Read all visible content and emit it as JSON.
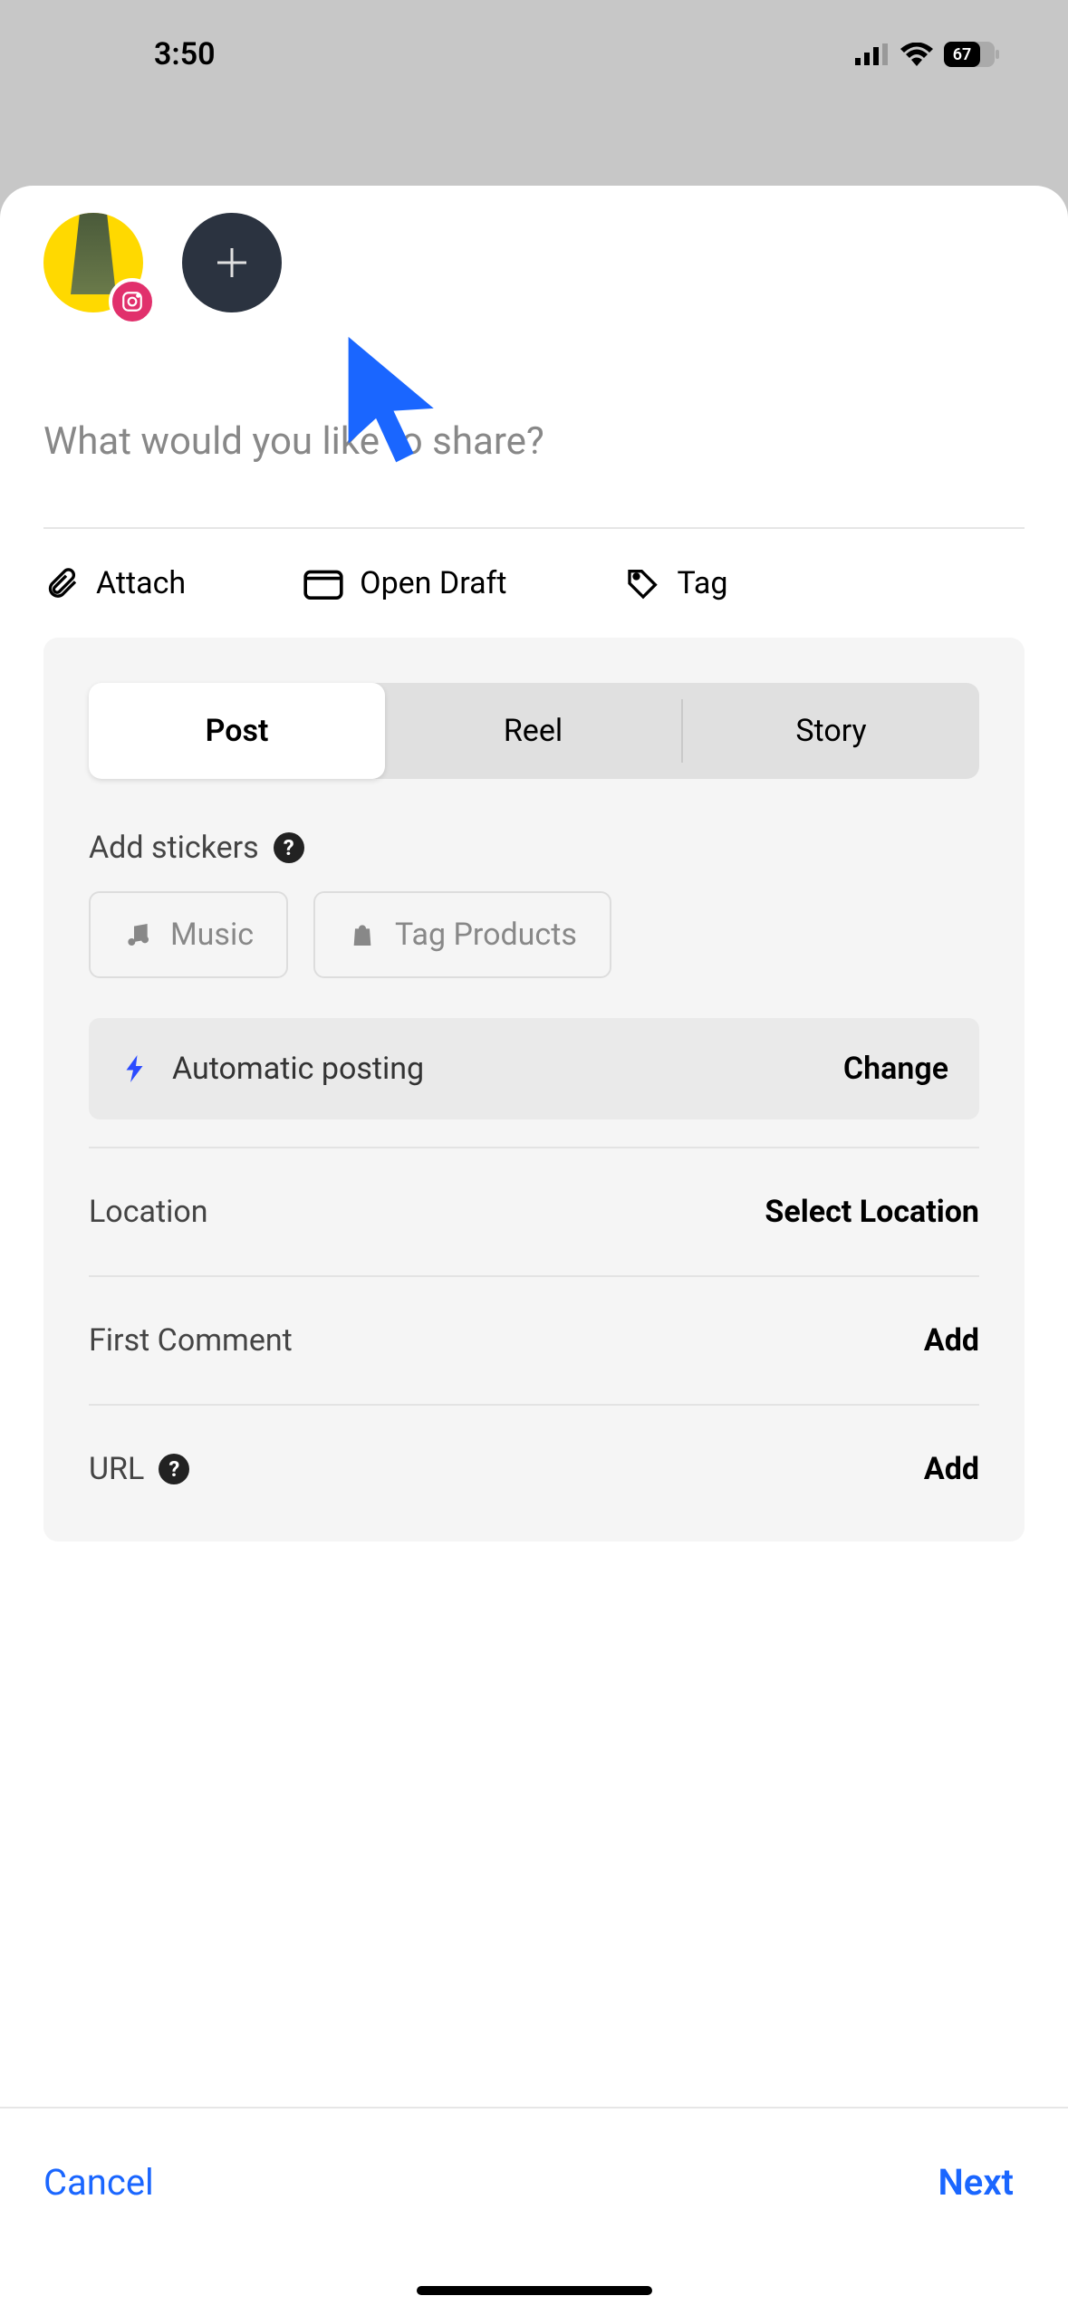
{
  "status": {
    "time": "3:50",
    "battery": "67"
  },
  "compose": {
    "placeholder": "What would you like to share?"
  },
  "actions": {
    "attach": "Attach",
    "open_draft": "Open Draft",
    "tag": "Tag"
  },
  "tabs": {
    "post": "Post",
    "reel": "Reel",
    "story": "Story"
  },
  "stickers": {
    "label": "Add stickers",
    "music": "Music",
    "tag_products": "Tag Products"
  },
  "auto_post": {
    "label": "Automatic posting",
    "action": "Change"
  },
  "rows": {
    "location": {
      "label": "Location",
      "action": "Select Location"
    },
    "first_comment": {
      "label": "First Comment",
      "action": "Add"
    },
    "url": {
      "label": "URL",
      "action": "Add"
    }
  },
  "footer": {
    "cancel": "Cancel",
    "next": "Next"
  }
}
